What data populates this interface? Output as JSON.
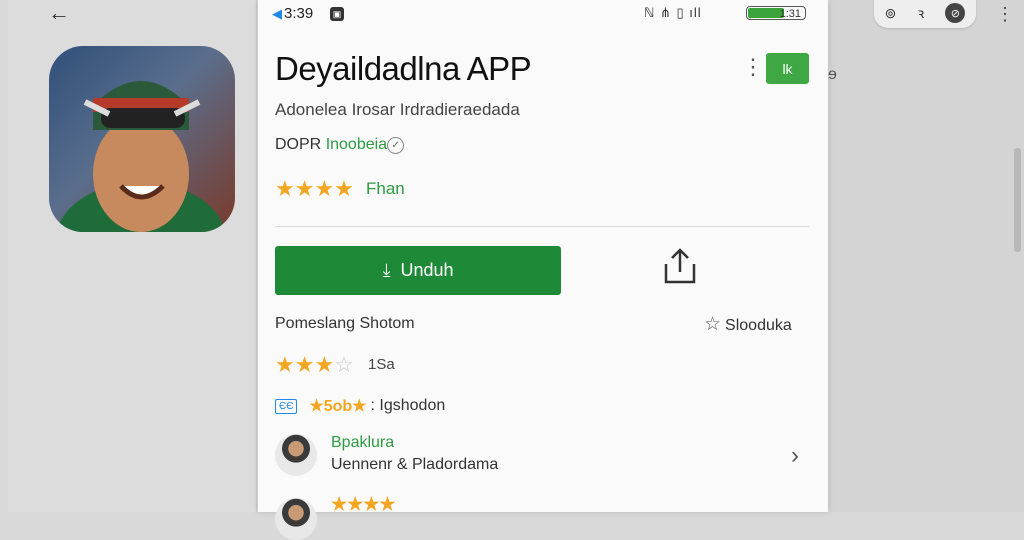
{
  "background": {
    "back_glyph": "←",
    "top_pill": {
      "icon1": "⊚",
      "icon2": "ꝛ",
      "icon3": "⊘"
    },
    "kebab": "⋮",
    "fragment": "ɘ"
  },
  "status_bar": {
    "time": "3:39",
    "right_icons": "ℕ ⋔ ▯ ıll",
    "battery": "1:31"
  },
  "app": {
    "title": "Deyaildadlna APP",
    "subtitle": "Adonelea Irosar Irdradieraedada",
    "developer_prefix": "DOPR",
    "developer_name": "Inoobeia",
    "rating_stars": "★★★★",
    "rating_label": "Fhan",
    "mini_button": "lk",
    "download_label": "Unduh"
  },
  "details": {
    "section_title": "Pomeslang Shotom",
    "wishlist_label": "Slooduka",
    "rating_stars_full": "★★★",
    "rating_stars_empty": "☆",
    "rating_count": "1Sa",
    "badge": "ЄЄ",
    "badge_stars": "★5ob★",
    "badge_text": ": Igshodon"
  },
  "reviews": [
    {
      "name": "Bpaklura",
      "text": "Uennenr & Pladordama"
    },
    {
      "stars": "★★★★"
    }
  ]
}
